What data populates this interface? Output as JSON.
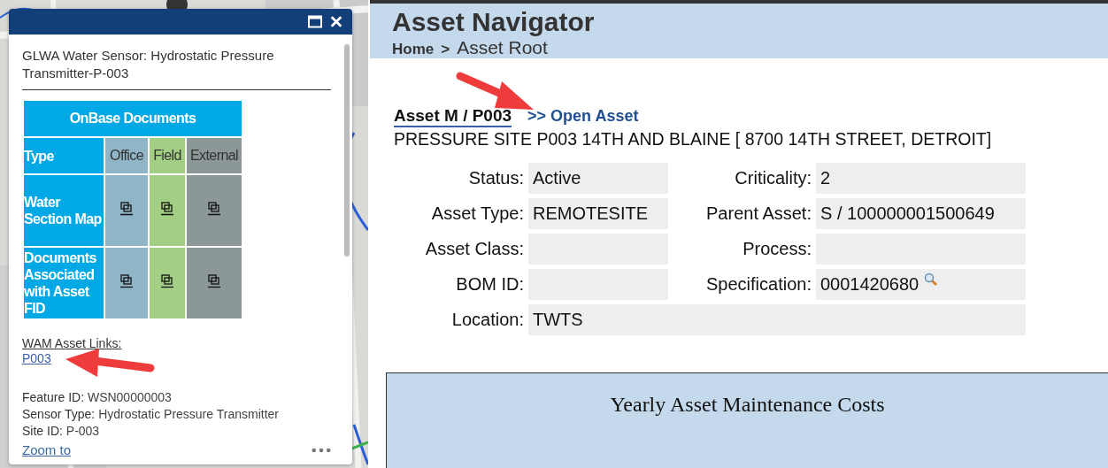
{
  "popup": {
    "title": "GLWA Water Sensor: Hydrostatic Pressure Transmitter-P-003",
    "documents_table": {
      "title": "OnBase Documents",
      "type_label": "Type",
      "columns": [
        {
          "label": "Office",
          "color": "#8fb5c7"
        },
        {
          "label": "Field",
          "color": "#a3cf84"
        },
        {
          "label": "External",
          "color": "#8c9897"
        }
      ],
      "rows": [
        {
          "label": "Water Section Map"
        },
        {
          "label": "Documents Associated with Asset FID"
        }
      ]
    },
    "links_heading": "WAM Asset Links:",
    "link": "P003",
    "attributes": [
      {
        "label": "Feature ID:",
        "value": "WSN00000003"
      },
      {
        "label": "Sensor Type:",
        "value": "Hydrostatic Pressure Transmitter"
      },
      {
        "label": "Site ID:",
        "value": "P-003"
      }
    ],
    "zoom_link": "Zoom to"
  },
  "navigator": {
    "title": "Asset Navigator",
    "breadcrumb": [
      {
        "label": "Home",
        "kind": "link"
      },
      {
        "label": ">",
        "kind": "separator"
      },
      {
        "label": "Asset Root",
        "kind": "current"
      }
    ],
    "asset_title": "Asset M / P003",
    "open_link": ">> Open Asset",
    "description": "PRESSURE SITE P003 14TH AND BLAINE [ 8700 14TH STREET, DETROIT]",
    "fields": [
      {
        "label": "Status:",
        "value": "Active"
      },
      {
        "label": "Criticality:",
        "value": "2"
      },
      {
        "label": "Asset Type:",
        "value": "REMOTESITE"
      },
      {
        "label": "Parent Asset:",
        "value": "S / 100000001500649"
      },
      {
        "label": "Asset Class:"
      },
      {
        "label": "Process:"
      },
      {
        "label": "BOM ID:"
      },
      {
        "label": "Specification:",
        "value": "0001420680",
        "lookup": true
      },
      {
        "label": "Location:",
        "value": "TWTS",
        "wide": true
      }
    ],
    "chart_title": "Yearly Asset Maintenance Costs"
  }
}
